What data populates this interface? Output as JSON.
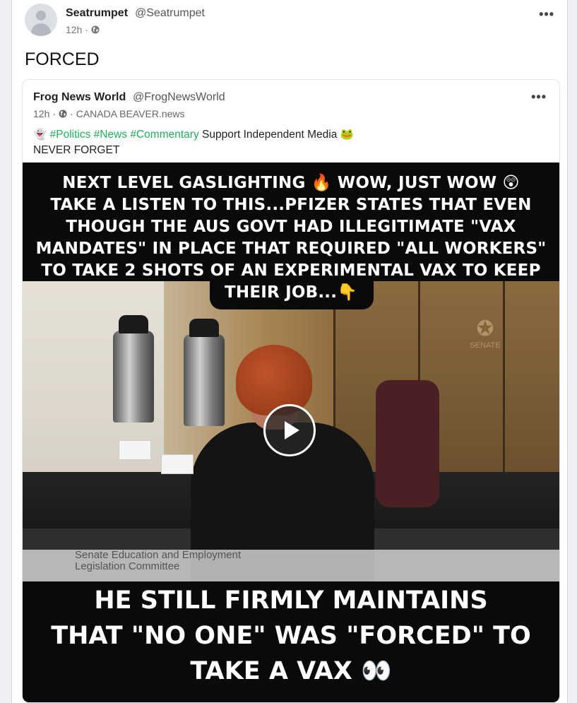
{
  "post": {
    "author_name": "Seatrumpet",
    "author_handle": "@Seatrumpet",
    "time": "12h",
    "separator": "·",
    "text": "FORCED"
  },
  "quoted": {
    "author_name": "Frog News World",
    "author_handle": "@FrogNewsWorld",
    "time": "12h",
    "source": "CANADA BEAVER.news",
    "body_emoji_start": "👻",
    "hashtags": [
      "#Politics",
      "#News",
      "#Commentary"
    ],
    "body_suffix": "Support Independent Media",
    "body_emoji_end": "🐸",
    "body_line2": "NEVER FORGET",
    "video": {
      "caption_top_lines": [
        "NEXT LEVEL GASLIGHTING 🔥 WOW, JUST WOW 😲",
        "TAKE A LISTEN TO THIS...PFIZER STATES THAT EVEN",
        "THOUGH THE AUS GOVT HAD ILLEGITIMATE \"VAX",
        "MANDATES\" IN PLACE THAT REQUIRED \"ALL WORKERS\"",
        "TO TAKE 2 SHOTS OF AN EXPERIMENTAL VAX TO KEEP",
        "THEIR JOB...👇"
      ],
      "caption_bottom_lines": [
        "HE STILL FIRMLY MAINTAINS",
        "THAT \"NO ONE\" WAS \"FORCED\" TO",
        "TAKE A VAX 👀"
      ],
      "banner_lines": [
        "Senate Education and Employment",
        "Legislation Committee"
      ],
      "crest_text": "SENATE"
    }
  },
  "icons": {
    "more": "more-horizontal-icon",
    "globe": "globe-icon",
    "play": "play-icon"
  },
  "colors": {
    "hashtag": "#1fae5b",
    "background": "#eef0f5"
  }
}
